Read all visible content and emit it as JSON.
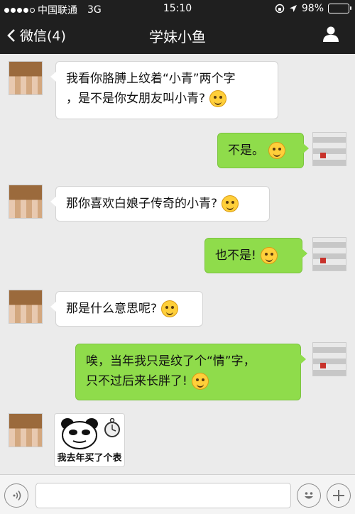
{
  "status_bar": {
    "carrier": "中国联通",
    "network": "3G",
    "time": "15:10",
    "battery_percent": "98%",
    "battery_level": 0.98
  },
  "nav": {
    "back_label": "微信(4)",
    "title": "学妹小鱼"
  },
  "messages": [
    {
      "side": "left",
      "lines": [
        "我看你胳膊上纹着“小青”两个字",
        "，是不是你女朋友叫小青?"
      ],
      "emoji": "smile-emoji"
    },
    {
      "side": "right",
      "lines": [
        "不是。"
      ],
      "emoji": "heart-eyes-emoji"
    },
    {
      "side": "left",
      "lines": [
        "那你喜欢白娘子传奇的小青?"
      ],
      "emoji": "surprised-emoji"
    },
    {
      "side": "right",
      "lines": [
        "也不是!"
      ],
      "emoji": "sunglasses-emoji"
    },
    {
      "side": "left",
      "lines": [
        "那是什么意思呢?"
      ],
      "emoji": "confused-emoji"
    },
    {
      "side": "right",
      "lines": [
        "唉，当年我只是纹了个“情”字，",
        "只不过后来长胖了!"
      ],
      "emoji": "tears-of-joy-emoji"
    },
    {
      "side": "left",
      "sticker_caption": "我去年买了个表"
    }
  ],
  "input": {
    "placeholder": ""
  },
  "colors": {
    "bar_bg": "#1f1f1f",
    "chat_bg": "#ebebeb",
    "sent_bubble": "#8fdc4b",
    "received_bubble": "#ffffff",
    "battery": "#58d64a"
  }
}
